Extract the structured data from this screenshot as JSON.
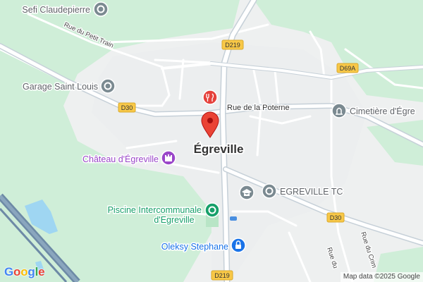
{
  "map": {
    "places": {
      "sefi": "Sefi Claudepierre",
      "garage": "Garage Saint Louis",
      "chateau": "Château d'Égreville",
      "piscine_line1": "Piscine Intercommunale",
      "piscine_line2": "d'Egreville",
      "oleksy": "Oleksy Stephane",
      "egreville_tc": "EGREVILLE TC",
      "cemetery": "Cimetière d'Égre",
      "town": "Égreville"
    },
    "streets": {
      "petit_train": "Rue du Petit Train",
      "poterne": "Rue de la Poterne",
      "rue_du": "Rue du",
      "rue_du_crim": "Rue du Crim"
    },
    "route_shields": {
      "d219_top": "D219",
      "d219_bottom": "D219",
      "d30_left": "D30",
      "d30_right": "D30",
      "d69a": "D69A"
    },
    "attribution": "Map data ©2025 Google",
    "logo": [
      "G",
      "o",
      "o",
      "g",
      "l",
      "e"
    ],
    "colors": {
      "green": "#cfeed8",
      "land": "#eef0f0",
      "road": "#ffffff",
      "main_road": "#c9d4dc",
      "water": "#9fd6f2",
      "poi_gray": "#7b8a91",
      "poi_purple": "#9a46c9",
      "poi_green": "#17a06a",
      "poi_blue": "#1a73e8",
      "poi_red": "#e5413b",
      "pin_red": "#ea4335",
      "shield": "#f8c847"
    }
  }
}
